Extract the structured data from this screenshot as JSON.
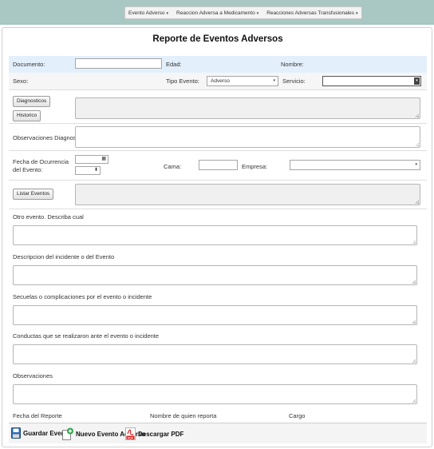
{
  "menu": {
    "items": [
      "Evento Adverso",
      "Reaccion Adversa a Medicamento",
      "Reacciones Adversas Transfusionales"
    ],
    "caret": "▾"
  },
  "title": "Reporte de Eventos Adversos",
  "row1": {
    "documento": "Documento:",
    "edad": "Edad:",
    "nombre": "Nombre:"
  },
  "row2": {
    "sexo": "Sexo:",
    "tipo_evento": "Tipo Evento:",
    "tipo_evento_value": "Adverso",
    "servicio": "Servicio:"
  },
  "buttons": {
    "diagnosticos": "Diagnosticos",
    "historico": "Historico",
    "listar_eventos": "Listar Eventos"
  },
  "observaciones_diagnostico": "Observaciones Diagnostico:",
  "fecha_ocurrencia": "Fecha de Ocurrencia del Evento:",
  "cama": "Cama:",
  "empresa": "Empresa:",
  "sections": [
    "Otro evento. Describa cual",
    "Descripcion del incidente o del Evento",
    "Secuelas o complicaciones por el evento o incidente",
    "Conductas que se realizaron ante el evento o incidente",
    "Observaciones"
  ],
  "footer_labels": {
    "fecha_reporte": "Fecha del Reporte",
    "nombre_reporta": "Nombre de quien reporta",
    "cargo": "Cargo"
  },
  "toolbar": {
    "guardar": "Guardar Evento",
    "nuevo": "Nuevo Evento Adverso",
    "pdf": "Descargar PDF",
    "pdf_badge": "PDF"
  },
  "colors": {
    "topbar": "#a9c7c3",
    "highlight_row": "#e3f0fb"
  }
}
